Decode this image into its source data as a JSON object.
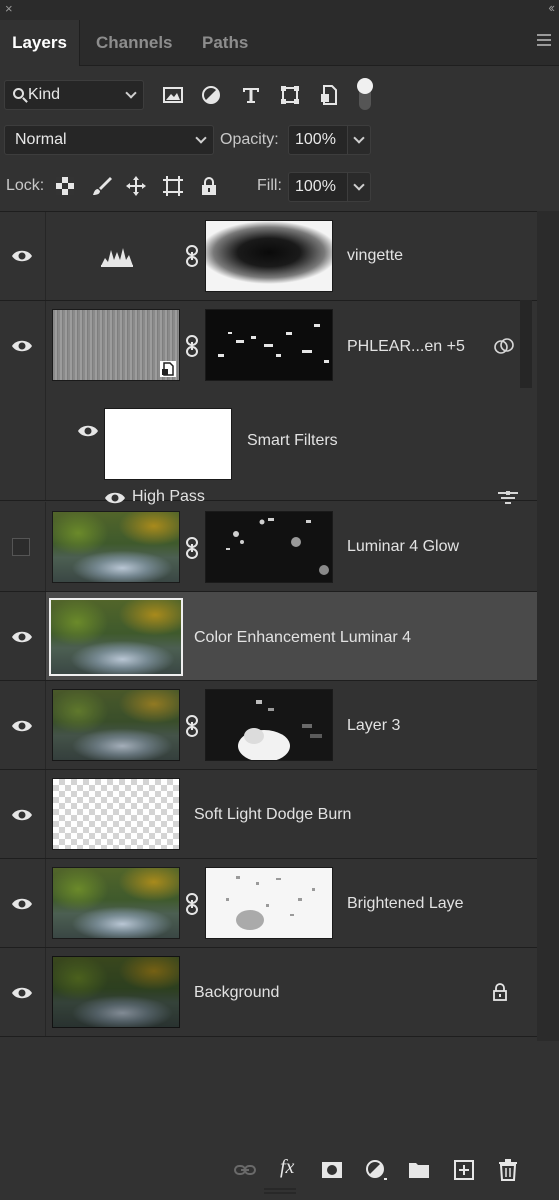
{
  "window": {
    "close_glyph": "×",
    "collapse_glyph": "‹‹"
  },
  "tabs": [
    {
      "label": "Layers",
      "active": true
    },
    {
      "label": "Channels",
      "active": false
    },
    {
      "label": "Paths",
      "active": false
    }
  ],
  "filter": {
    "kind_label": "Kind",
    "icons": [
      "image-filter-icon",
      "adjustment-filter-icon",
      "type-filter-icon",
      "shape-filter-icon",
      "smart-object-filter-icon",
      "filter-toggle-icon"
    ]
  },
  "blend": {
    "mode": "Normal",
    "opacity_label": "Opacity:",
    "opacity_value": "100%"
  },
  "lock": {
    "label": "Lock:",
    "icons": [
      "lock-transparent-pixels-icon",
      "lock-image-pixels-icon",
      "lock-position-icon",
      "lock-artboard-icon",
      "lock-all-icon"
    ],
    "fill_label": "Fill:",
    "fill_value": "100%"
  },
  "layers": [
    {
      "name": "vingette",
      "visible": true,
      "type": "levels-adjustment"
    },
    {
      "name": "PHLEAR...en +5",
      "visible": true,
      "type": "smart-object"
    },
    {
      "name": "Smart Filters",
      "visible": true,
      "type": "smart-filters"
    },
    {
      "name": "High Pass",
      "visible": true,
      "type": "filter"
    },
    {
      "name": "Luminar 4 Glow",
      "visible": false,
      "type": "pixel-with-mask"
    },
    {
      "name": "Color Enhancement Luminar 4",
      "visible": true,
      "type": "pixel",
      "selected": true
    },
    {
      "name": "Layer 3",
      "visible": true,
      "type": "pixel-with-mask"
    },
    {
      "name": "Soft Light Dodge Burn",
      "visible": true,
      "type": "transparent"
    },
    {
      "name": "Brightened Laye",
      "visible": true,
      "type": "pixel-with-mask"
    },
    {
      "name": "Background",
      "visible": true,
      "type": "background",
      "locked": true
    }
  ],
  "footer_icons": [
    "link-layers-icon",
    "fx-icon",
    "add-mask-icon",
    "new-adjustment-icon",
    "new-group-icon",
    "new-layer-icon",
    "delete-layer-icon"
  ],
  "footer": {
    "fx_label": "fx"
  },
  "colors": {
    "panel": "#323232",
    "selected_row": "#4a4a4a",
    "tab_active_text": "#ffffff"
  }
}
